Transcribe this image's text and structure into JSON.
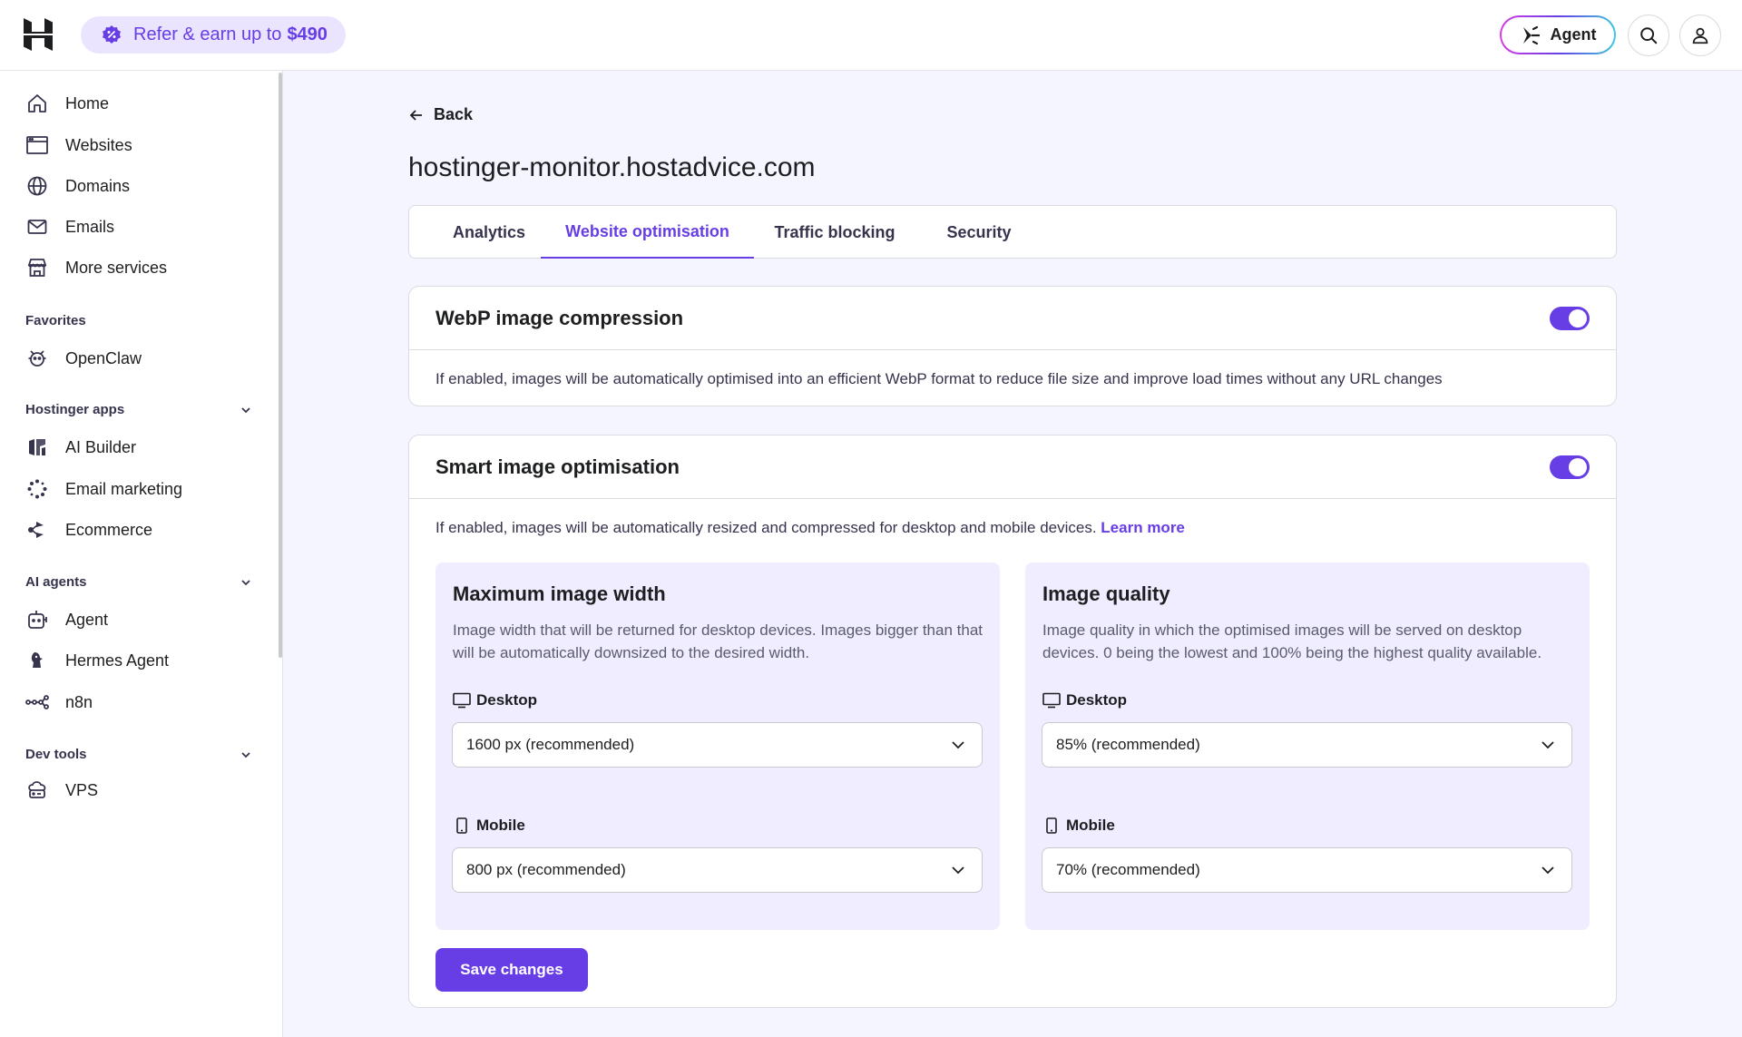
{
  "header": {
    "refer_text": "Refer & earn up to",
    "refer_amount": "$490",
    "agent_label": "Agent"
  },
  "sidebar": {
    "main": [
      {
        "label": "Home",
        "icon": "home-icon"
      },
      {
        "label": "Websites",
        "icon": "browser-icon"
      },
      {
        "label": "Domains",
        "icon": "globe-icon"
      },
      {
        "label": "Emails",
        "icon": "mail-icon"
      },
      {
        "label": "More services",
        "icon": "store-icon"
      }
    ],
    "favorites_label": "Favorites",
    "favorites": [
      {
        "label": "OpenClaw",
        "icon": "claw-icon"
      }
    ],
    "apps_label": "Hostinger apps",
    "apps": [
      {
        "label": "AI Builder",
        "icon": "ai-builder-icon"
      },
      {
        "label": "Email marketing",
        "icon": "email-marketing-icon"
      },
      {
        "label": "Ecommerce",
        "icon": "ecommerce-icon"
      }
    ],
    "agents_label": "AI agents",
    "agents": [
      {
        "label": "Agent",
        "icon": "agent-icon"
      },
      {
        "label": "Hermes Agent",
        "icon": "hermes-icon"
      },
      {
        "label": "n8n",
        "icon": "n8n-icon"
      }
    ],
    "devtools_label": "Dev tools",
    "devtools": [
      {
        "label": "VPS",
        "icon": "vps-icon"
      }
    ]
  },
  "main": {
    "back_label": "Back",
    "title": "hostinger-monitor.hostadvice.com",
    "tabs": [
      {
        "label": "Analytics"
      },
      {
        "label": "Website optimisation"
      },
      {
        "label": "Traffic blocking"
      },
      {
        "label": "Security"
      }
    ],
    "webp": {
      "title": "WebP image compression",
      "enabled": true,
      "description": "If enabled, images will be automatically optimised into an efficient WebP format to reduce file size and improve load times without any URL changes"
    },
    "smart": {
      "title": "Smart image optimisation",
      "enabled": true,
      "description": "If enabled, images will be automatically resized and compressed for desktop and mobile devices.",
      "learn_more": "Learn more",
      "width_panel": {
        "title": "Maximum image width",
        "description": "Image width that will be returned for desktop devices. Images bigger than that will be automatically downsized to the desired width.",
        "desktop_label": "Desktop",
        "desktop_value": "1600 px (recommended)",
        "mobile_label": "Mobile",
        "mobile_value": "800 px (recommended)"
      },
      "quality_panel": {
        "title": "Image quality",
        "description": "Image quality in which the optimised images will be served on desktop devices. 0 being the lowest and 100% being the highest quality available.",
        "desktop_label": "Desktop",
        "desktop_value": "85% (recommended)",
        "mobile_label": "Mobile",
        "mobile_value": "70% (recommended)"
      },
      "save_label": "Save changes"
    }
  },
  "colors": {
    "accent": "#673de6",
    "panel_bg": "#efedff",
    "page_bg": "#f4f5ff"
  }
}
